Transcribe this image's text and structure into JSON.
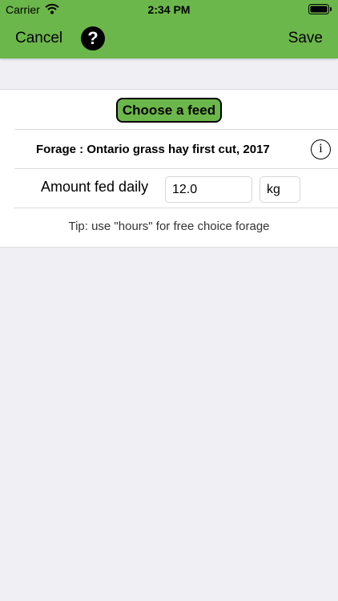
{
  "status_bar": {
    "carrier": "Carrier",
    "time": "2:34 PM"
  },
  "nav": {
    "cancel_label": "Cancel",
    "help_symbol": "?",
    "save_label": "Save"
  },
  "feed": {
    "choose_label": "Choose a feed",
    "name": "Forage : Ontario grass hay first cut, 2017",
    "info_symbol": "i"
  },
  "amount": {
    "label": "Amount fed daily",
    "value": "12.0",
    "unit": "kg"
  },
  "tip": "Tip: use \"hours\" for free choice forage",
  "colors": {
    "accent": "#6cb74b",
    "background": "#efeff4"
  }
}
